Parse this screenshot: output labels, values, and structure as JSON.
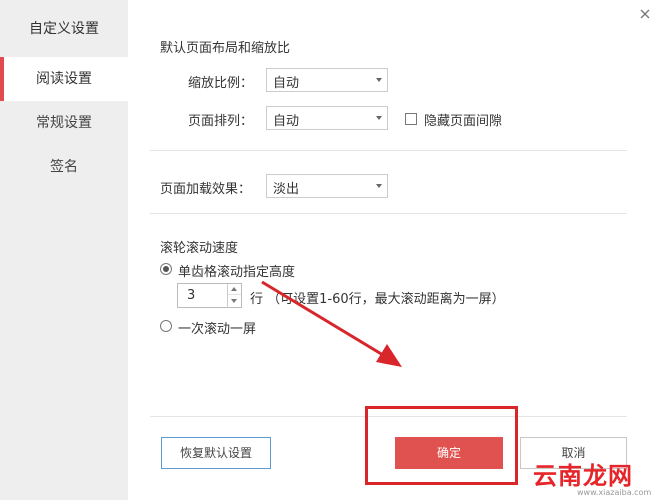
{
  "sidebar": {
    "title": "自定义设置",
    "items": [
      {
        "label": "阅读设置",
        "active": true
      },
      {
        "label": "常规设置",
        "active": false
      },
      {
        "label": "签名",
        "active": false
      }
    ]
  },
  "layout_section": {
    "title": "默认页面布局和缩放比",
    "zoom_label": "缩放比例：",
    "zoom_value": "自动",
    "arrange_label": "页面排列：",
    "arrange_value": "自动",
    "hide_gap_label": "隐藏页面间隙",
    "hide_gap_checked": false
  },
  "load_section": {
    "label": "页面加载效果：",
    "value": "淡出"
  },
  "scroll_section": {
    "title": "滚轮滚动速度",
    "option1_label": "单齿格滚动指定高度",
    "option1_checked": true,
    "lines_value": "3",
    "lines_hint": "行  （可设置1-60行，最大滚动距离为一屏）",
    "option2_label": "一次滚动一屏",
    "option2_checked": false
  },
  "buttons": {
    "restore": "恢复默认设置",
    "ok": "确定",
    "cancel": "取消"
  },
  "watermark": {
    "main": "云南龙网",
    "sub": "www.xiazaiba.com"
  },
  "colors": {
    "accent": "#e14b4f",
    "ok_button": "#e0524f",
    "annotation": "#d8262b",
    "sidebar_bg": "#eeeeee"
  }
}
